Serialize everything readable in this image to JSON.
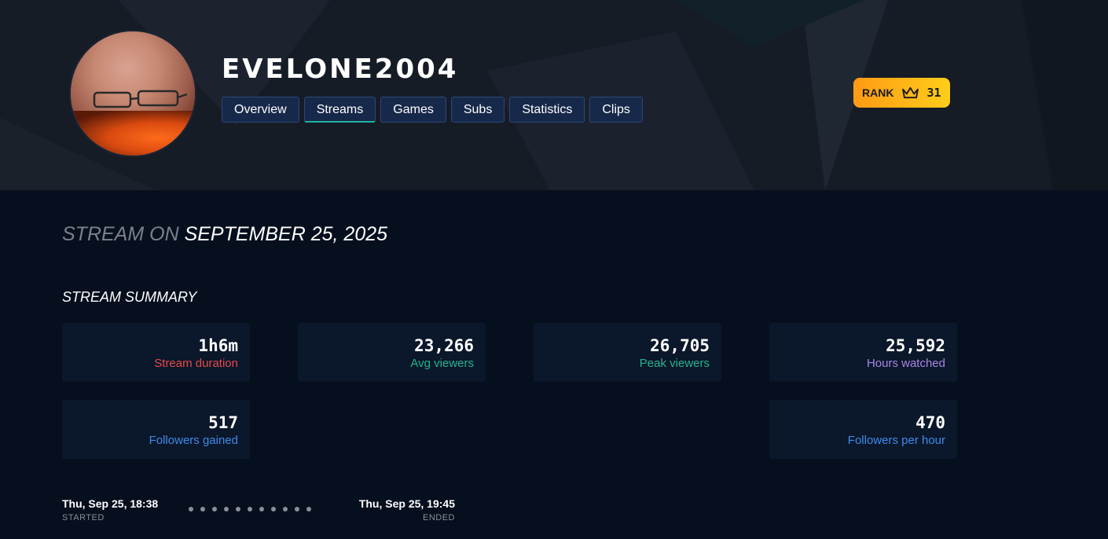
{
  "header": {
    "channel_name": "EVELONE2004",
    "tabs": [
      {
        "label": "Overview",
        "active": false
      },
      {
        "label": "Streams",
        "active": true
      },
      {
        "label": "Games",
        "active": false
      },
      {
        "label": "Subs",
        "active": false
      },
      {
        "label": "Statistics",
        "active": false
      },
      {
        "label": "Clips",
        "active": false
      }
    ],
    "rank": {
      "label": "RANK",
      "icon": "crown-icon",
      "value": "31"
    }
  },
  "page": {
    "heading_prefix": "STREAM ON",
    "heading_date": "SEPTEMBER 25, 2025"
  },
  "summary": {
    "title": "STREAM SUMMARY",
    "cards": [
      {
        "value": "1h6m",
        "label": "Stream duration",
        "color": "#e84a4a"
      },
      {
        "value": "23,266",
        "label": "Avg viewers",
        "color": "#22b58f"
      },
      {
        "value": "26,705",
        "label": "Peak viewers",
        "color": "#22b58f"
      },
      {
        "value": "25,592",
        "label": "Hours watched",
        "color": "#a986e6"
      },
      {
        "value": "517",
        "label": "Followers gained",
        "color": "#3c8cec"
      },
      {
        "value": "470",
        "label": "Followers per hour",
        "color": "#3c8cec"
      }
    ]
  },
  "timeline": {
    "started": {
      "time": "Thu, Sep 25, 18:38",
      "label": "STARTED"
    },
    "ended": {
      "time": "Thu, Sep 25, 19:45",
      "label": "ENDED"
    }
  },
  "colors": {
    "background": "#060f1e",
    "tab_active_underline": "#21b39a",
    "rank_gradient_start": "#ff9a14",
    "rank_gradient_end": "#ffce1a"
  }
}
